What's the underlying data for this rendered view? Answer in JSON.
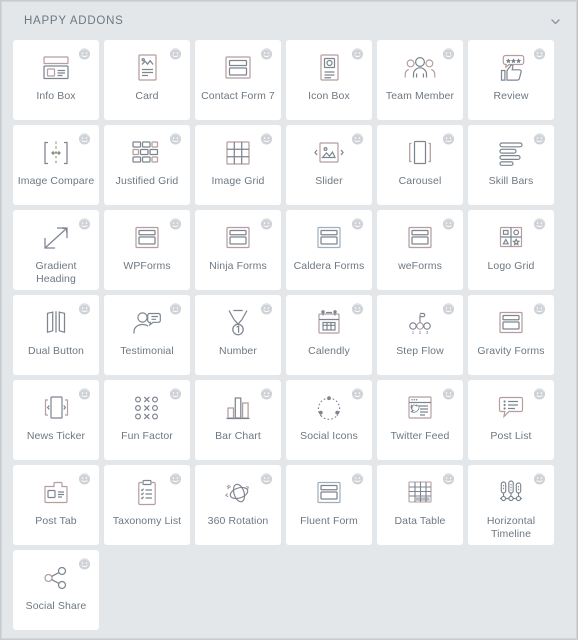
{
  "header": {
    "title": "HAPPY ADDONS",
    "toggle_icon": "chevron-down-icon"
  },
  "colors": {
    "window_background": "#c9ccce",
    "panel_background": "#e3e7e9",
    "card_background": "#ffffff",
    "text": "#6d7882",
    "icon_stroke": "#7d858f",
    "badge": "#c7ccd1"
  },
  "badge": {
    "icon": "happy-addons-pro-badge-icon"
  },
  "widgets": [
    {
      "label": "Info Box",
      "icon": "info-box-icon"
    },
    {
      "label": "Card",
      "icon": "card-icon"
    },
    {
      "label": "Contact Form 7",
      "icon": "contact-form-7-icon"
    },
    {
      "label": "Icon Box",
      "icon": "icon-box-icon"
    },
    {
      "label": "Team Member",
      "icon": "team-member-icon"
    },
    {
      "label": "Review",
      "icon": "review-icon"
    },
    {
      "label": "Image Compare",
      "icon": "image-compare-icon"
    },
    {
      "label": "Justified Grid",
      "icon": "justified-grid-icon"
    },
    {
      "label": "Image Grid",
      "icon": "image-grid-icon"
    },
    {
      "label": "Slider",
      "icon": "slider-icon"
    },
    {
      "label": "Carousel",
      "icon": "carousel-icon"
    },
    {
      "label": "Skill Bars",
      "icon": "skill-bars-icon"
    },
    {
      "label": "Gradient\nHeading",
      "icon": "gradient-heading-icon"
    },
    {
      "label": "WPForms",
      "icon": "wpforms-icon"
    },
    {
      "label": "Ninja Forms",
      "icon": "ninja-forms-icon"
    },
    {
      "label": "Caldera Forms",
      "icon": "caldera-forms-icon"
    },
    {
      "label": "weForms",
      "icon": "weforms-icon"
    },
    {
      "label": "Logo Grid",
      "icon": "logo-grid-icon"
    },
    {
      "label": "Dual Button",
      "icon": "dual-button-icon"
    },
    {
      "label": "Testimonial",
      "icon": "testimonial-icon"
    },
    {
      "label": "Number",
      "icon": "number-icon"
    },
    {
      "label": "Calendly",
      "icon": "calendly-icon"
    },
    {
      "label": "Step Flow",
      "icon": "step-flow-icon"
    },
    {
      "label": "Gravity Forms",
      "icon": "gravity-forms-icon"
    },
    {
      "label": "News Ticker",
      "icon": "news-ticker-icon"
    },
    {
      "label": "Fun Factor",
      "icon": "fun-factor-icon"
    },
    {
      "label": "Bar Chart",
      "icon": "bar-chart-icon"
    },
    {
      "label": "Social Icons",
      "icon": "social-icons-icon"
    },
    {
      "label": "Twitter Feed",
      "icon": "twitter-feed-icon"
    },
    {
      "label": "Post List",
      "icon": "post-list-icon"
    },
    {
      "label": "Post Tab",
      "icon": "post-tab-icon"
    },
    {
      "label": "Taxonomy List",
      "icon": "taxonomy-list-icon"
    },
    {
      "label": "360 Rotation",
      "icon": "360-rotation-icon"
    },
    {
      "label": "Fluent Form",
      "icon": "fluent-form-icon"
    },
    {
      "label": "Data Table",
      "icon": "data-table-icon"
    },
    {
      "label": "Horizontal\nTimeline",
      "icon": "horizontal-timeline-icon"
    },
    {
      "label": "Social Share",
      "icon": "social-share-icon"
    }
  ]
}
